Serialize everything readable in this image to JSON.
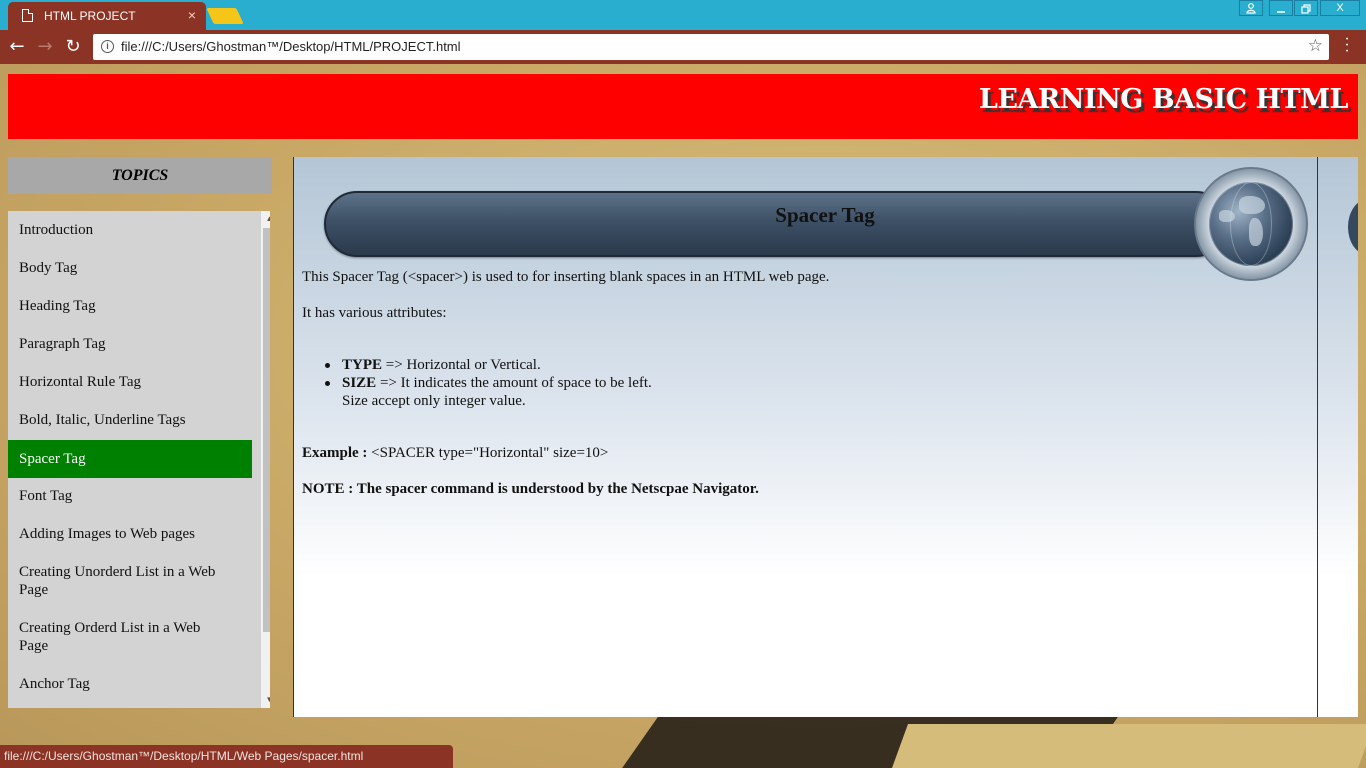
{
  "browser": {
    "tab_title": "HTML PROJECT",
    "tab_close": "×",
    "url": "file:///C:/Users/Ghostman™/Desktop/HTML/PROJECT.html",
    "status_url": "file:///C:/Users/Ghostman™/Desktop/HTML/Web Pages/spacer.html",
    "nav": {
      "back": "←",
      "forward": "→",
      "reload": "↻"
    },
    "window_buttons": {
      "profile": "👤",
      "minimize": "—",
      "restore": "❐",
      "close": "X"
    },
    "icons": [
      "page-icon",
      "info-icon",
      "star-icon",
      "menu-icon"
    ]
  },
  "banner": {
    "title": "LEARNING BASIC HTML"
  },
  "sidebar": {
    "header": "TOPICS",
    "items": [
      {
        "label": "Introduction",
        "active": false
      },
      {
        "label": "Body Tag",
        "active": false
      },
      {
        "label": "Heading Tag",
        "active": false
      },
      {
        "label": "Paragraph Tag",
        "active": false
      },
      {
        "label": "Horizontal Rule Tag",
        "active": false
      },
      {
        "label": "Bold, Italic, Underline Tags",
        "active": false
      },
      {
        "label": "Spacer Tag",
        "active": true
      },
      {
        "label": "Font Tag",
        "active": false
      },
      {
        "label": "Adding Images to Web pages",
        "active": false
      },
      {
        "label": "Creating Unorderd List in a Web Page",
        "active": false
      },
      {
        "label": "Creating Orderd List in a Web Page",
        "active": false
      },
      {
        "label": "Anchor Tag",
        "active": false
      }
    ]
  },
  "content": {
    "title": "Spacer Tag",
    "intro": "This Spacer Tag (<spacer>) is used to for inserting blank spaces in an HTML web page.",
    "attributes_label": "It has various attributes:",
    "bullets": [
      {
        "name": "TYPE",
        "arrow": "=>",
        "text": "Horizontal or Vertical."
      },
      {
        "name": "SIZE",
        "arrow": "=>",
        "text": "It indicates the amount of space to be left.",
        "extra": "Size accept only integer value."
      }
    ],
    "example_label": "Example :",
    "example_code": "<SPACER type=\"Horizontal\" size=10>",
    "note": "NOTE : The spacer command is understood by the Netscpae Navigator."
  },
  "colors": {
    "banner": "#ff0000",
    "active_item": "#008000",
    "chrome": "#8b3324",
    "titlebar": "#2aaed0"
  }
}
